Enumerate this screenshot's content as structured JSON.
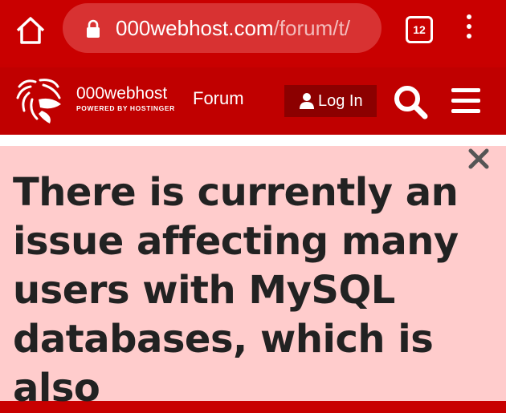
{
  "browser": {
    "url_domain": "000webhost.com",
    "url_path": "/forum/t/",
    "tab_count": "12",
    "icons": [
      "home-icon",
      "lock-icon",
      "tabs-icon",
      "more-vert-icon"
    ]
  },
  "header": {
    "brand_name": "000webhost",
    "brand_tagline": "POWERED BY HOSTINGER",
    "nav_forum": "Forum",
    "login_label": "Log In",
    "icons": [
      "logo-icon",
      "user-icon",
      "search-icon",
      "menu-icon"
    ]
  },
  "banner": {
    "message": "There is currently an issue affecting many users with MySQL databases, which is also",
    "close_icon": "close-icon"
  },
  "colors": {
    "chrome_red": "#c90000",
    "header_red": "#c00000",
    "login_bg": "#8c0000",
    "banner_bg": "#ffcccc",
    "banner_text": "#222222"
  }
}
